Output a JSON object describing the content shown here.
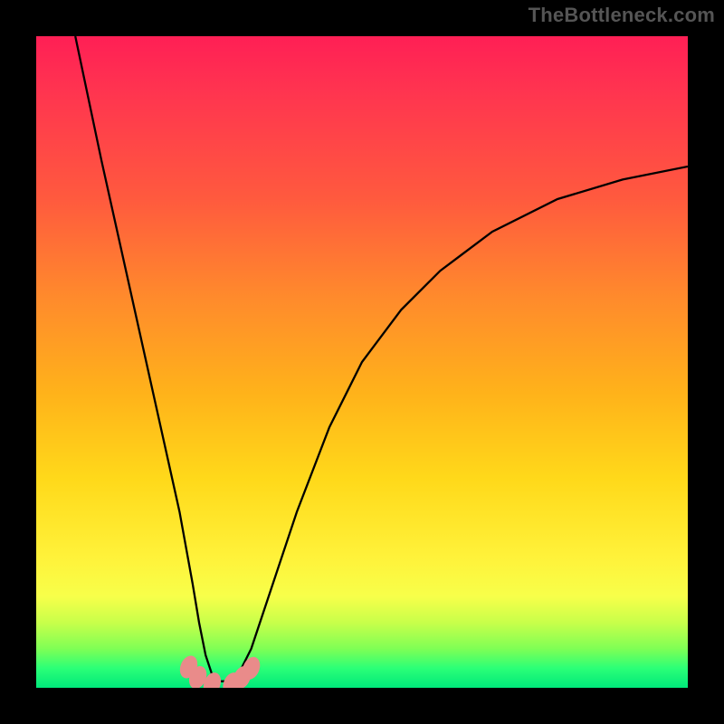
{
  "watermark": "TheBottleneck.com",
  "chart_data": {
    "type": "line",
    "title": "",
    "xlabel": "",
    "ylabel": "",
    "xlim": [
      0,
      100
    ],
    "ylim": [
      0,
      100
    ],
    "series": [
      {
        "name": "curve",
        "x": [
          6,
          10,
          14,
          18,
          22,
          24,
          25,
          26,
          27,
          28,
          30,
          31,
          33,
          36,
          40,
          45,
          50,
          56,
          62,
          70,
          80,
          90,
          100
        ],
        "y": [
          100,
          81,
          63,
          45,
          27,
          16,
          10,
          5,
          2,
          1,
          1,
          2,
          6,
          15,
          27,
          40,
          50,
          58,
          64,
          70,
          75,
          78,
          80
        ]
      },
      {
        "name": "markers",
        "x": [
          23.4,
          24.8,
          27.0,
          30.0,
          31.6,
          33.0
        ],
        "y": [
          3.2,
          1.6,
          0.6,
          0.6,
          1.6,
          3.0
        ]
      }
    ],
    "annotations": []
  },
  "colors": {
    "curve_stroke": "#000000",
    "marker_fill": "#e98b8a",
    "background_black": "#000000"
  }
}
